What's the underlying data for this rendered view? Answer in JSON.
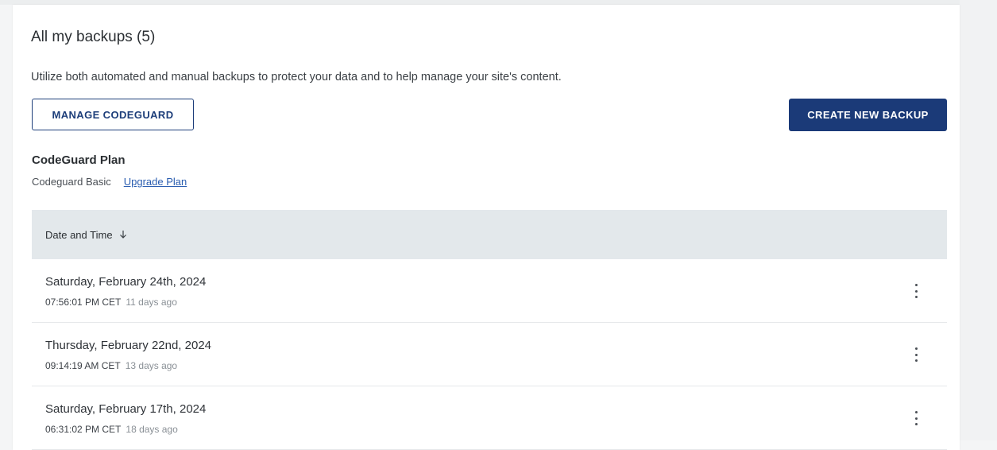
{
  "backups": {
    "title": "All my backups (5)",
    "description": "Utilize both automated and manual backups to protect your data and to help manage your site's content.",
    "manage_button": "MANAGE CODEGUARD",
    "create_button": "CREATE NEW BACKUP"
  },
  "plan": {
    "heading": "CodeGuard Plan",
    "name": "Codeguard Basic",
    "upgrade_link": "Upgrade Plan"
  },
  "table": {
    "column_header": "Date and Time",
    "sort_direction": "descending",
    "rows": [
      {
        "date": "Saturday, February 24th, 2024",
        "time": "07:56:01 PM CET",
        "ago": "11 days ago"
      },
      {
        "date": "Thursday, February 22nd, 2024",
        "time": "09:14:19 AM CET",
        "ago": "13 days ago"
      },
      {
        "date": "Saturday, February 17th, 2024",
        "time": "06:31:02 PM CET",
        "ago": "18 days ago"
      }
    ]
  },
  "icons": {
    "sort": "arrow-down-icon",
    "row_menu": "more-vertical-icon"
  },
  "colors": {
    "primary": "#1b3a78",
    "link": "#2a5db0",
    "table_header_bg": "#e3e8eb"
  }
}
